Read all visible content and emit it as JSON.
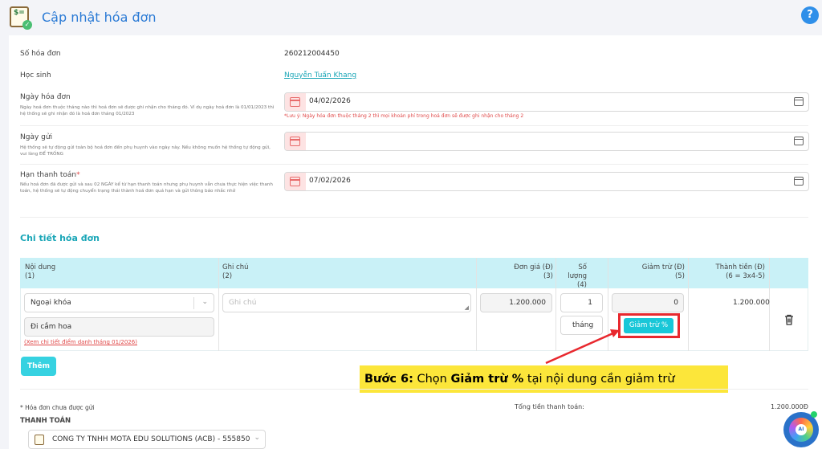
{
  "header": {
    "title": "Cập nhật hóa đơn",
    "logo_text": "$=",
    "help": "?"
  },
  "fields": {
    "invoice_no": {
      "label": "Số hóa đơn",
      "value": "260212004450"
    },
    "student": {
      "label": "Học sinh",
      "value": "Nguyễn Tuấn Khang"
    },
    "invoice_date": {
      "label": "Ngày hóa đơn",
      "hint": "Ngày hoá đơn thuộc tháng nào thì hoá đơn sẽ được ghi nhận cho tháng đó. Ví dụ ngày hoá đơn là 01/01/2023 thì hệ thống sẽ ghi nhận đó là hoá đơn tháng 01/2023",
      "value": "04/02/2026",
      "note": "*Lưu ý: Ngày hóa đơn thuộc tháng 2 thì mọi khoản phí trong hoá đơn sẽ được ghi nhận cho tháng 2"
    },
    "send_date": {
      "label": "Ngày gửi",
      "hint": "Hệ thống sẽ tự động gửi toàn bộ hoá đơn đến phụ huynh vào ngày này. Nếu không muốn hệ thống tự động gửi, vui lòng ĐỂ TRỐNG",
      "value": ""
    },
    "due_date": {
      "label": "Hạn thanh toán",
      "required": "*",
      "hint": "Nếu hoá đơn đã được gửi và sau 02 NGÀY kể từ hạn thanh toán nhưng phụ huynh vẫn chưa thực hiện việc thanh toán, hệ thống sẽ tự động chuyển trạng thái thành hoá đơn quá hạn và gửi thông báo nhắc nhở",
      "value": "07/02/2026"
    }
  },
  "detail": {
    "title": "Chi tiết hóa đơn",
    "columns": [
      {
        "name": "Nội dung",
        "sub": "(1)"
      },
      {
        "name": "Ghi chú",
        "sub": "(2)"
      },
      {
        "name": "Đơn giá (Đ)",
        "sub": "(3)"
      },
      {
        "name": "Số lượng",
        "sub": "(4)"
      },
      {
        "name": "Giảm trừ (Đ)",
        "sub": "(5)"
      },
      {
        "name": "Thành tiền (Đ)",
        "sub": "(6 = 3x4-5)"
      }
    ],
    "row": {
      "category": "Ngoại khóa",
      "item": "Đi cắm hoa",
      "attendance_link": "(Xem chi tiết điểm danh tháng 01/2026)",
      "note_placeholder": "Ghi chú",
      "unit_price": "1.200.000",
      "quantity": "1",
      "unit": "tháng",
      "discount": "0",
      "discount_pct_button": "Giảm trừ %",
      "total": "1.200.000"
    },
    "add_button": "Thêm"
  },
  "callout": {
    "step": "Bước 6:",
    "text_1": " Chọn ",
    "bold": "Giảm trừ %",
    "text_2": " tại nội dung cần giảm trừ"
  },
  "footer": {
    "unsent_note": "* Hóa đơn chưa được gửi",
    "payment_title": "THANH TOÁN",
    "bank": "CONG TY TNHH MOTA EDU SOLUTIONS (ACB) - 555850",
    "total_label": "Tổng tiền thanh toán:",
    "total_value": "1.200.000Đ"
  },
  "ai_widget": {
    "label": "AI"
  },
  "colors": {
    "accent": "#1aa6b7",
    "header_bg": "#c9f1f7",
    "callout": "#fce63a",
    "highlight": "#e8282e"
  }
}
